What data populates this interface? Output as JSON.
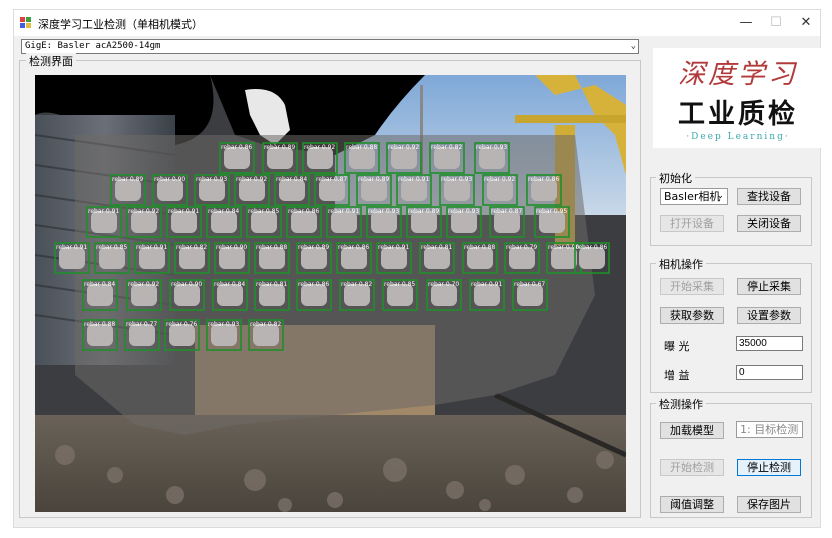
{
  "window": {
    "title": "深度学习工业检测（单相机模式）",
    "minimize_glyph": "—",
    "maximize_glyph": "☐",
    "close_glyph": "✕"
  },
  "device_combo": {
    "value": "GigE: Basler acA2500-14gm",
    "arrow": "⌄"
  },
  "detection_panel": {
    "title": "检测界面"
  },
  "logo": {
    "line1": "深度学习",
    "line2": "工业质检",
    "line3": "·Deep Learning·"
  },
  "init_group": {
    "title": "初始化",
    "camera_select": "Basler相机",
    "find_device": "查找设备",
    "open_device": "打开设备",
    "close_device": "关闭设备"
  },
  "camera_group": {
    "title": "相机操作",
    "start_capture": "开始采集",
    "stop_capture": "停止采集",
    "get_params": "获取参数",
    "set_params": "设置参数",
    "exposure_label": "曝  光",
    "exposure_value": "35000",
    "gain_label": "增  益",
    "gain_value": "0"
  },
  "detect_group": {
    "title": "检测操作",
    "load_model": "加载模型",
    "task_select": "1: 目标检测",
    "start_detect": "开始检测",
    "stop_detect": "停止检测",
    "threshold": "阈值调整",
    "save_image": "保存图片"
  },
  "detections": [
    {
      "label": "rebar 0.86"
    },
    {
      "label": "rebar 0.89"
    },
    {
      "label": "rebar 0.92"
    },
    {
      "label": "rebar 0.88"
    },
    {
      "label": "rebar 0.92"
    },
    {
      "label": "rebar 0.82"
    },
    {
      "label": "rebar 0.93"
    },
    {
      "label": "rebar 0.89"
    },
    {
      "label": "rebar 0.90"
    },
    {
      "label": "rebar 0.93"
    },
    {
      "label": "rebar 0.92"
    },
    {
      "label": "rebar 0.84"
    },
    {
      "label": "rebar 0.87"
    },
    {
      "label": "rebar 0.89"
    },
    {
      "label": "rebar 0.91"
    },
    {
      "label": "rebar 0.93"
    },
    {
      "label": "rebar 0.92"
    },
    {
      "label": "rebar 0.86"
    },
    {
      "label": "rebar 0.91"
    },
    {
      "label": "rebar 0.92"
    },
    {
      "label": "rebar 0.91"
    },
    {
      "label": "rebar 0.84"
    },
    {
      "label": "rebar 0.85"
    },
    {
      "label": "rebar 0.86"
    },
    {
      "label": "rebar 0.91"
    },
    {
      "label": "rebar 0.93"
    },
    {
      "label": "rebar 0.89"
    },
    {
      "label": "rebar 0.93"
    },
    {
      "label": "rebar 0.87"
    },
    {
      "label": "rebar 0.95"
    },
    {
      "label": "rebar 0.91"
    },
    {
      "label": "rebar 0.85"
    },
    {
      "label": "rebar 0.91"
    },
    {
      "label": "rebar 0.82"
    },
    {
      "label": "rebar 0.90"
    },
    {
      "label": "rebar 0.88"
    },
    {
      "label": "rebar 0.89"
    },
    {
      "label": "rebar 0.86"
    },
    {
      "label": "rebar 0.91"
    },
    {
      "label": "rebar 0.81"
    },
    {
      "label": "rebar 0.88"
    },
    {
      "label": "rebar 0.79"
    },
    {
      "label": "rebar 0.90"
    },
    {
      "label": "rebar 0.86"
    },
    {
      "label": "rebar 0.84"
    },
    {
      "label": "rebar 0.92"
    },
    {
      "label": "rebar 0.90"
    },
    {
      "label": "rebar 0.84"
    },
    {
      "label": "rebar 0.81"
    },
    {
      "label": "rebar 0.86"
    },
    {
      "label": "rebar 0.82"
    },
    {
      "label": "rebar 0.85"
    },
    {
      "label": "rebar 0.70"
    },
    {
      "label": "rebar 0.91"
    },
    {
      "label": "rebar 0.67"
    },
    {
      "label": "rebar 0.88"
    },
    {
      "label": "rebar 0.77"
    },
    {
      "label": "rebar 0.76"
    },
    {
      "label": "rebar 0.93"
    },
    {
      "label": "rebar 0.82"
    }
  ],
  "colors": {
    "detection_box": "#1f8f2a",
    "detection_label": "#ffffff",
    "logo_red": "#b23a3a",
    "logo_teal": "#3aa7b0"
  }
}
